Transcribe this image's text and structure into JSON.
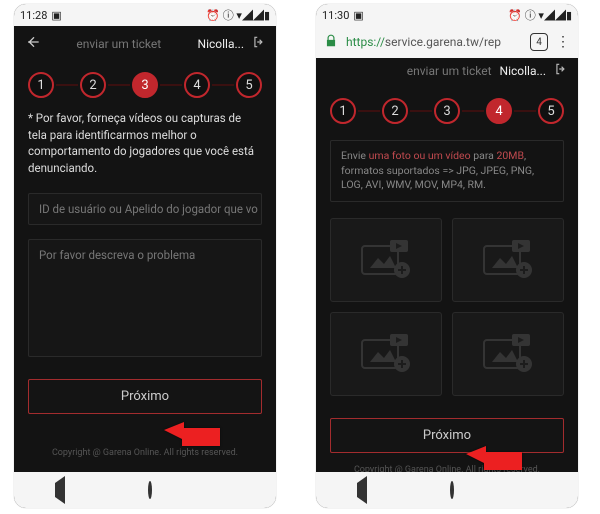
{
  "left": {
    "status": {
      "time": "11:28",
      "icons": "⏰ ⓘ ▾◢◢▮"
    },
    "app_header": {
      "title": "enviar um ticket",
      "user": "Nicolla..."
    },
    "steps": [
      "1",
      "2",
      "3",
      "4",
      "5"
    ],
    "active_step_index": 2,
    "instructions_text": "* Por favor, forneça vídeos ou capturas de tela para identificarmos melhor o comportamento do jogadores que você está denunciando.",
    "player_input_placeholder": "ID de usuário ou Apelido do jogador que vo",
    "problem_textarea_placeholder": "Por favor descreva o problema",
    "next_button_label": "Próximo",
    "footer_text": "Copyright @ Garena Online. All rights reserved."
  },
  "right": {
    "status": {
      "time": "11:30",
      "icons": "⏰ ⓘ ▾◢◢▮"
    },
    "browser": {
      "scheme": "https://",
      "host": "service.garena.tw",
      "path": "/rep",
      "tab_count": "4"
    },
    "app_header": {
      "title": "enviar um ticket",
      "user": "Nicolla..."
    },
    "steps": [
      "1",
      "2",
      "3",
      "4",
      "5"
    ],
    "active_step_index": 3,
    "upload_hint_prefix": "Envie ",
    "upload_hint_accent": "uma foto ou um vídeo",
    "upload_hint_mid": " para ",
    "upload_hint_size": "20MB",
    "upload_hint_suffix": ", formatos suportados => JPG, JPEG, PNG, LOG, AVI, WMV, MOV, MP4, RM.",
    "next_button_label": "Próximo",
    "footer_text": "Copyright @ Garena Online. All rights reserved."
  }
}
